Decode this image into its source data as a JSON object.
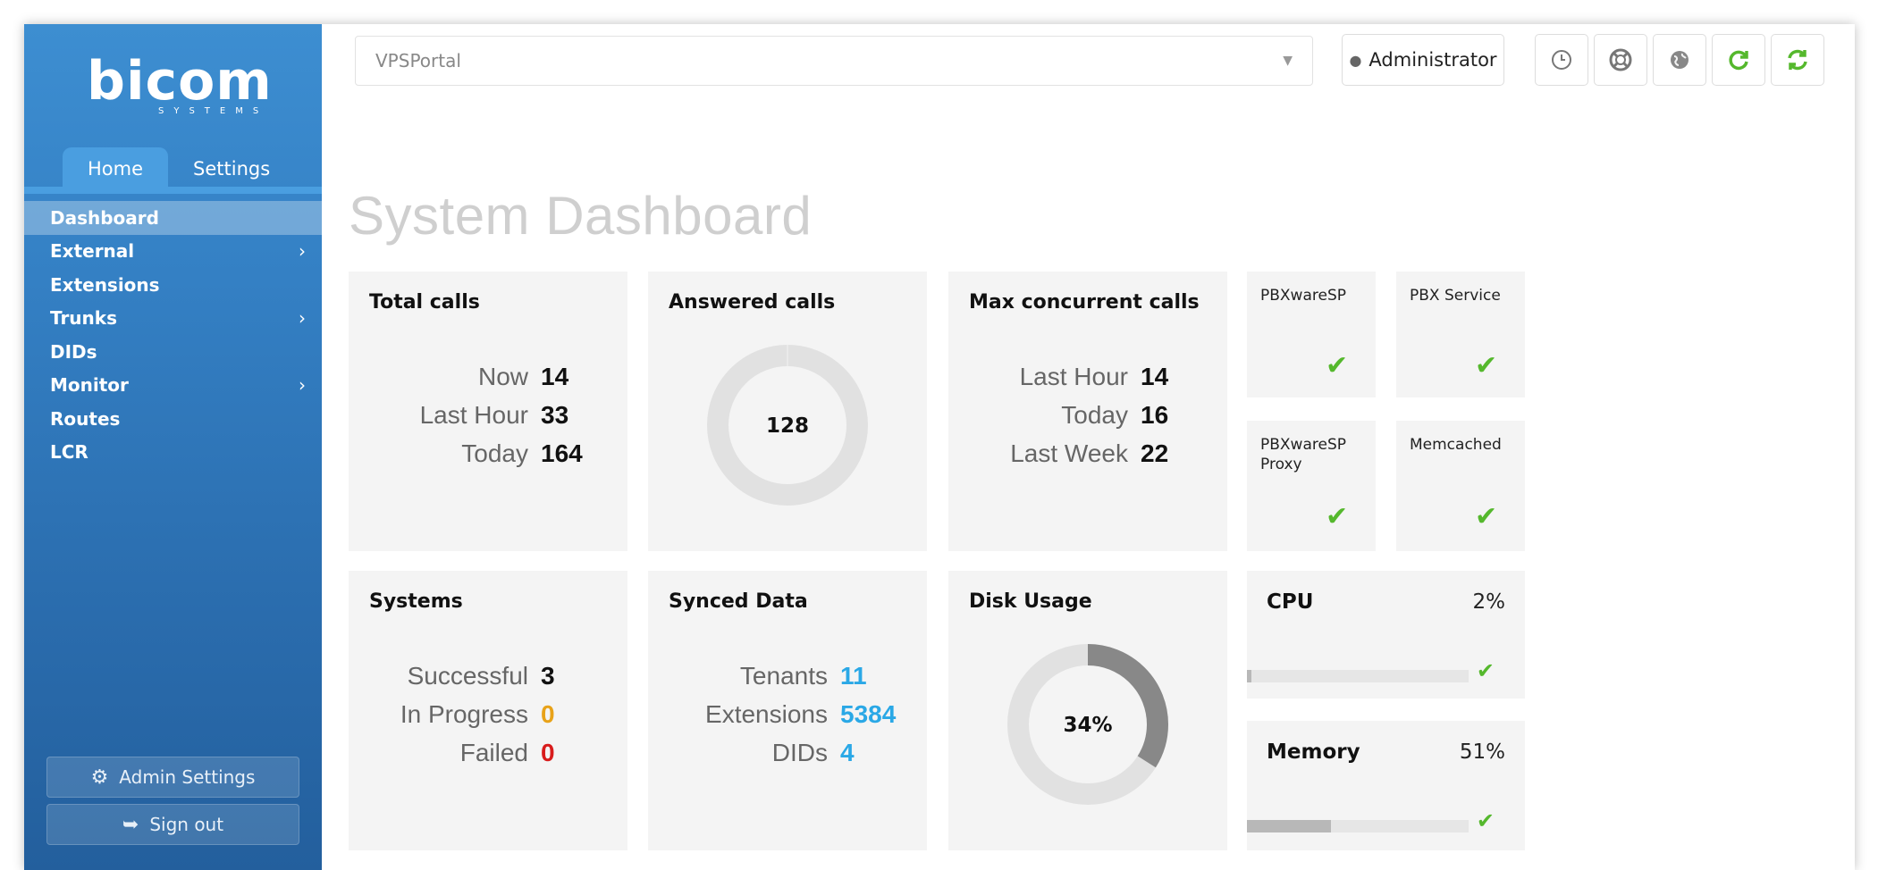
{
  "brand": {
    "logo": "bicom",
    "logo_sub": "SYSTEMS"
  },
  "sidebar": {
    "tabs": [
      {
        "label": "Home",
        "active": true
      },
      {
        "label": "Settings",
        "active": false
      }
    ],
    "items": [
      {
        "label": "Dashboard",
        "active": true,
        "chevron": ""
      },
      {
        "label": "External",
        "chevron": "›"
      },
      {
        "label": "Extensions",
        "chevron": ""
      },
      {
        "label": "Trunks",
        "chevron": "›"
      },
      {
        "label": "DIDs",
        "chevron": ""
      },
      {
        "label": "Monitor",
        "chevron": "›"
      },
      {
        "label": "Routes",
        "chevron": ""
      },
      {
        "label": "LCR",
        "chevron": ""
      }
    ],
    "admin_settings": "Admin Settings",
    "sign_out": "Sign out"
  },
  "topbar": {
    "portal": "VPSPortal",
    "user": "Administrator",
    "icons": [
      "clock-icon",
      "lifebuoy-icon",
      "globe-icon",
      "reload-icon",
      "refresh-icon"
    ]
  },
  "page_title": "System Dashboard",
  "total_calls": {
    "title": "Total calls",
    "rows": [
      {
        "label": "Now",
        "value": "14"
      },
      {
        "label": "Last Hour",
        "value": "33"
      },
      {
        "label": "Today",
        "value": "164"
      }
    ]
  },
  "answered_calls": {
    "title": "Answered calls",
    "value": "128"
  },
  "max_concurrent": {
    "title": "Max concurrent calls",
    "rows": [
      {
        "label": "Last Hour",
        "value": "14"
      },
      {
        "label": "Today",
        "value": "16"
      },
      {
        "label": "Last Week",
        "value": "22"
      }
    ]
  },
  "services": [
    {
      "name": "PBXwareSP",
      "status": "ok"
    },
    {
      "name": "PBX Service",
      "status": "ok"
    },
    {
      "name": "PBXwareSP Proxy",
      "status": "ok"
    },
    {
      "name": "Memcached",
      "status": "ok"
    }
  ],
  "systems": {
    "title": "Systems",
    "rows": [
      {
        "label": "Successful",
        "value": "3"
      },
      {
        "label": "In Progress",
        "value": "0"
      },
      {
        "label": "Failed",
        "value": "0"
      }
    ]
  },
  "synced": {
    "title": "Synced Data",
    "rows": [
      {
        "label": "Tenants",
        "value": "11"
      },
      {
        "label": "Extensions",
        "value": "5384"
      },
      {
        "label": "DIDs",
        "value": "4"
      }
    ]
  },
  "disk": {
    "title": "Disk Usage",
    "value": "34%",
    "fraction": 0.34
  },
  "cpu": {
    "title": "CPU",
    "value": "2%",
    "fraction": 0.02
  },
  "memory": {
    "title": "Memory",
    "value": "51%",
    "fraction": 0.38
  },
  "colors": {
    "accent": "#3d8ed1",
    "ok": "#55b82d",
    "warn": "#e8a219",
    "error": "#d81c1c",
    "info": "#2aa8e6"
  }
}
